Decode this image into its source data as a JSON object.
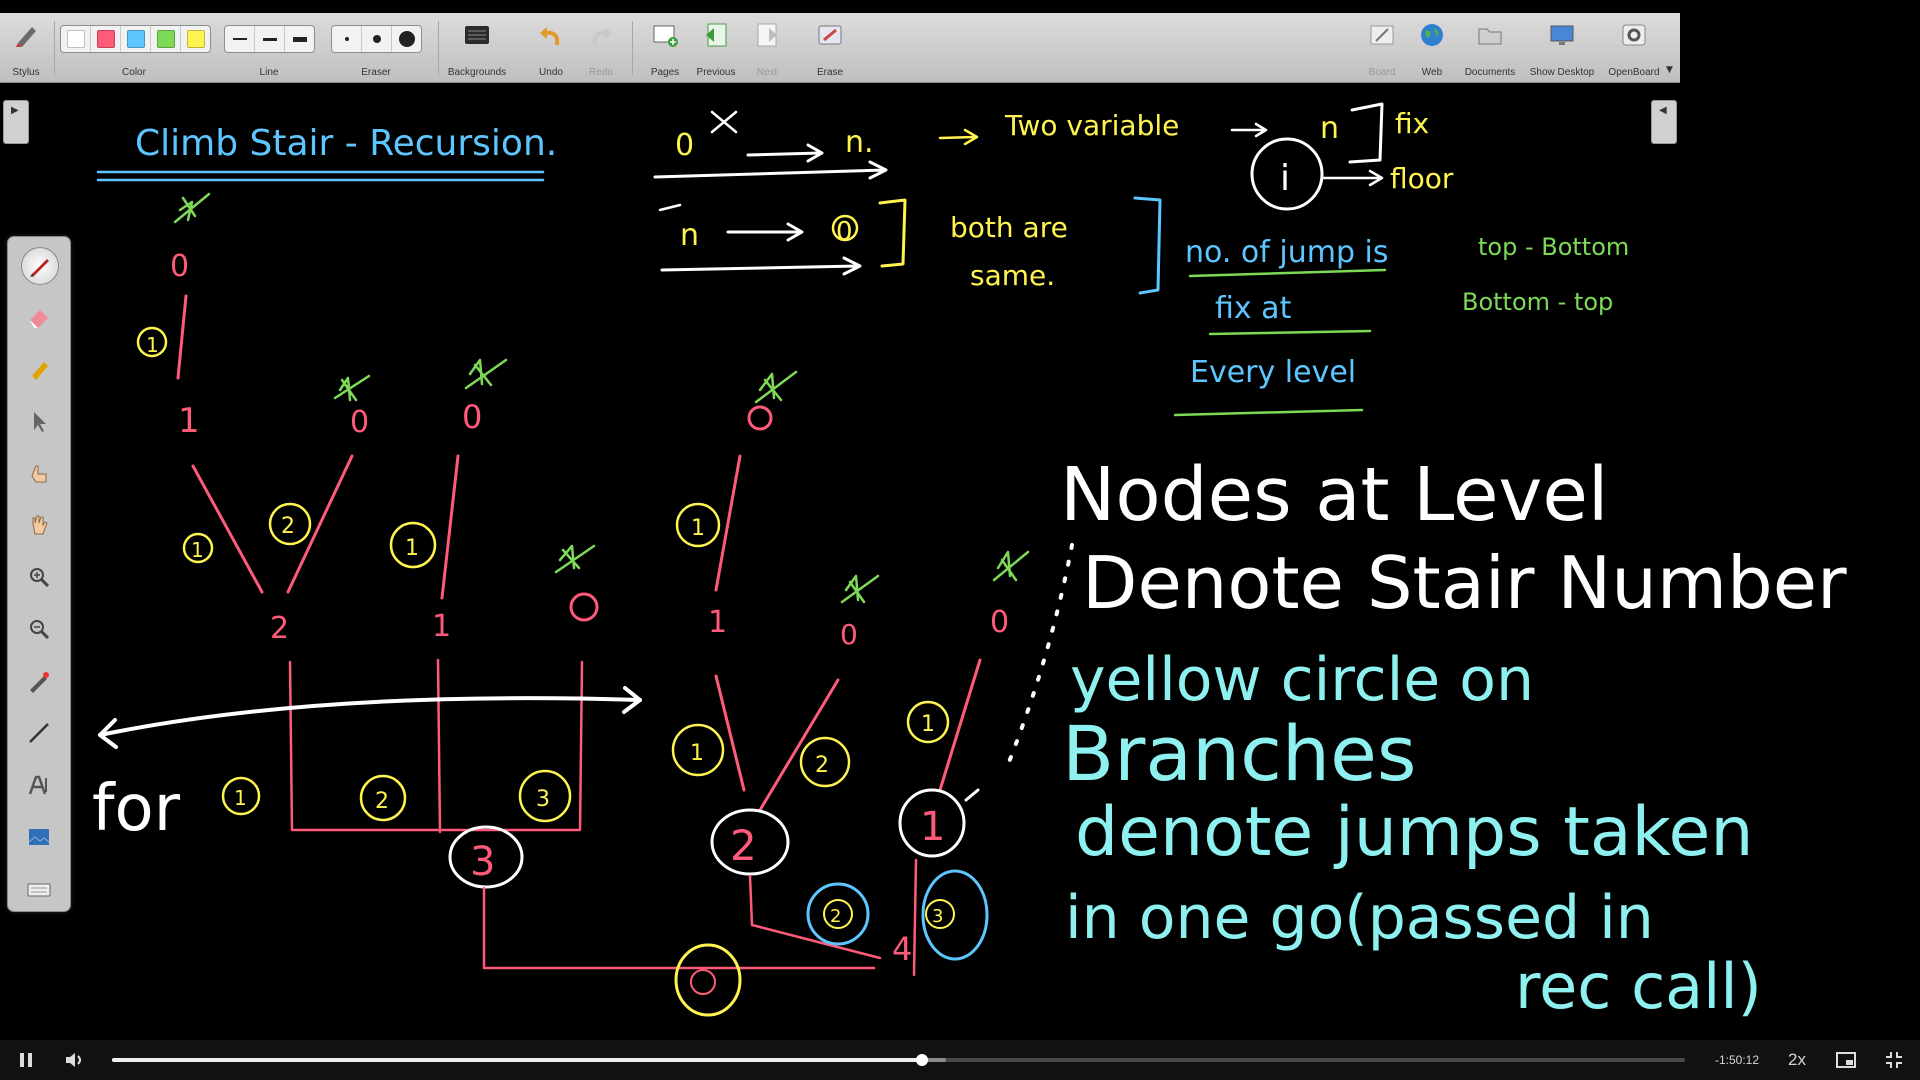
{
  "toolbar": {
    "stylus": "Stylus",
    "color": "Color",
    "line": "Line",
    "eraser": "Eraser",
    "backgrounds": "Backgrounds",
    "undo": "Undo",
    "redo": "Redo",
    "pages": "Pages",
    "previous": "Previous",
    "next": "Next",
    "erase": "Erase",
    "board": "Board",
    "web": "Web",
    "documents": "Documents",
    "show_desktop": "Show Desktop",
    "openboard": "OpenBoard",
    "colors": [
      "#ffffff",
      "#ff5a7a",
      "#5ec6ff",
      "#7ed957",
      "#fff44f"
    ]
  },
  "board": {
    "title": "Climb Stair - Recursion.",
    "top": {
      "zero": "0",
      "n1": "n.",
      "two_var": "Two variable",
      "n2": "n",
      "fix": "fix",
      "i": "i",
      "floor": "floor",
      "n3": "n",
      "zero2": "0",
      "both_same_1": "both are",
      "both_same_2": "same.",
      "jumps_1": "no. of jump is",
      "jumps_2": "fix at",
      "jumps_3": "Every level",
      "top_bottom": "top - Bottom",
      "bottom_top": "Bottom - top"
    },
    "tree": {
      "root": "4",
      "n3": "3",
      "n2a": "2",
      "n1a": "1",
      "n0a": "0",
      "n1b": "1",
      "n0b": "0",
      "n0c": "0",
      "n2b": "2",
      "n1c": "1",
      "n0d": "0",
      "n0e": "0",
      "n1d": "1",
      "n0f": "0",
      "n0g": "0",
      "j1": "1",
      "j2": "2",
      "j3": "3",
      "for": "for"
    },
    "notes": {
      "line1": "Nodes at Level",
      "line2": "Denote Stair Number",
      "line3": "yellow circle on",
      "line4": "Branches",
      "line5": "denote jumps taken",
      "line6": "in one go(passed in",
      "line7": "rec call)"
    },
    "ink_colors": {
      "blue": "#5ec6ff",
      "yellow": "#fff44f",
      "green": "#7ed957",
      "red": "#ff5a7a",
      "white": "#ffffff",
      "cyan": "#8ff0f0"
    }
  },
  "player": {
    "time_remaining": "-1:50:12",
    "speed": "2x",
    "progress": 0.515,
    "buffered": 0.53
  }
}
